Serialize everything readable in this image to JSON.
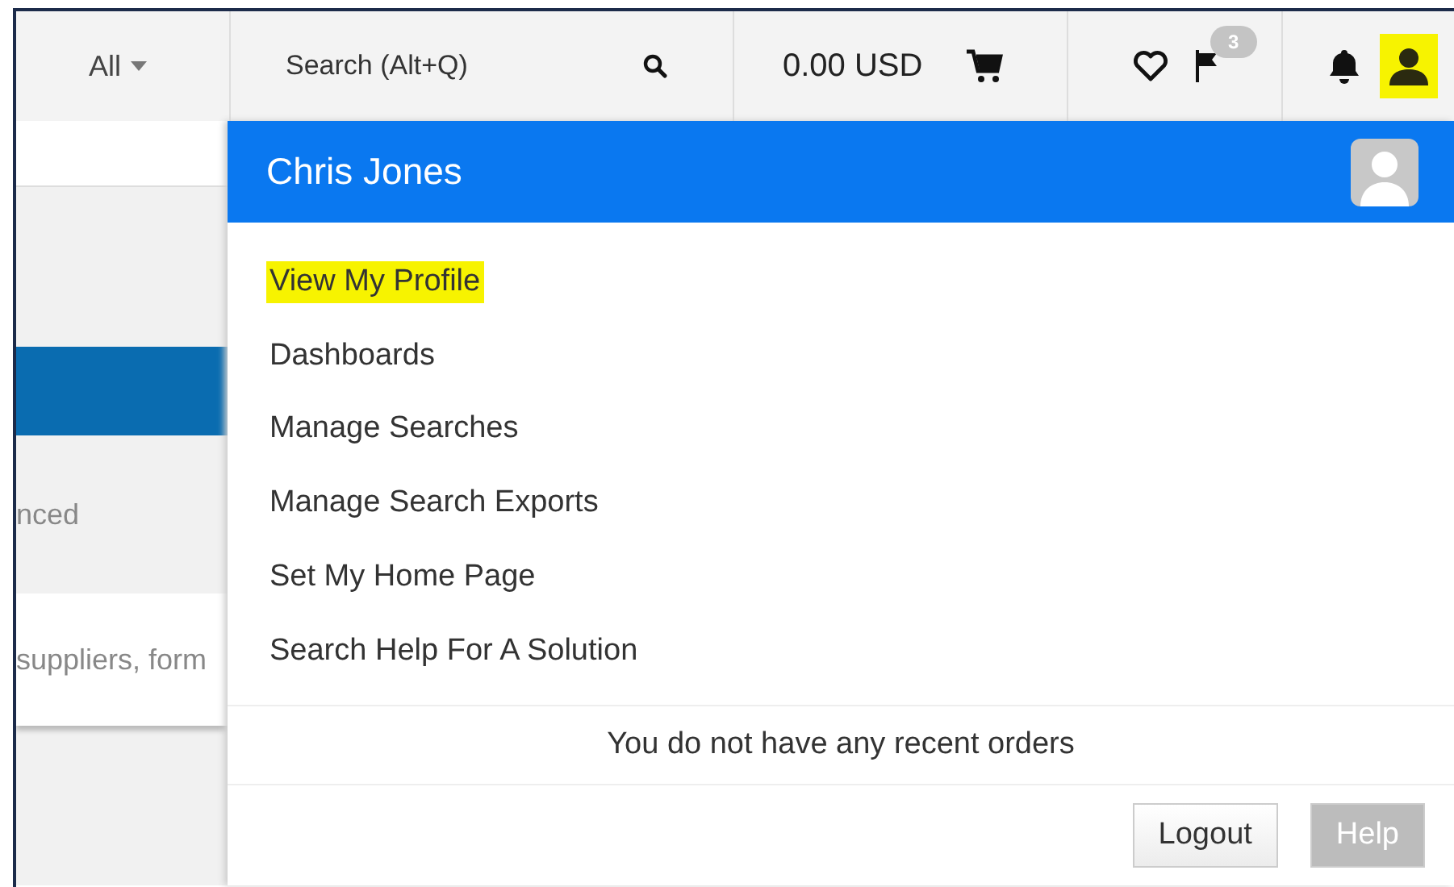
{
  "toolbar": {
    "scope": "All",
    "search": {
      "placeholder": "Search (Alt+Q)"
    },
    "cart_total": "0.00 USD",
    "flag_badge": "3",
    "user_highlighted": true
  },
  "background": {
    "partial_text_1": "nced",
    "partial_text_2": "suppliers, form"
  },
  "user_menu": {
    "name": "Chris Jones",
    "items": [
      {
        "label": "View My Profile",
        "highlighted": true
      },
      {
        "label": "Dashboards",
        "highlighted": false
      },
      {
        "label": "Manage Searches",
        "highlighted": false
      },
      {
        "label": "Manage Search Exports",
        "highlighted": false
      },
      {
        "label": "Set My Home Page",
        "highlighted": false
      },
      {
        "label": "Search Help For A Solution",
        "highlighted": false
      }
    ],
    "recent_orders": "You do not have any recent orders",
    "buttons": [
      {
        "label": "Logout",
        "disabled": false
      },
      {
        "label": "Help",
        "disabled": true
      }
    ]
  }
}
